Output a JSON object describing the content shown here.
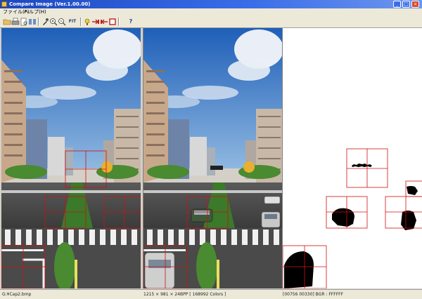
{
  "window": {
    "title": "Compare Image (Ver.1.00.00)",
    "controls": [
      "_",
      "□",
      "×"
    ]
  },
  "menu": {
    "items": [
      "ファイル(F)",
      "ヘルプ(H)"
    ]
  },
  "toolbar": {
    "icons": [
      "open-folder-icon",
      "print-icon",
      "print-preview-icon",
      "compare-icon",
      "eyedropper-icon",
      "zoom-in-icon",
      "zoom-out-icon",
      "fit-to-window-icon",
      "marker-icon",
      "next-diff-icon",
      "prev-diff-icon",
      "stop-icon",
      "help-icon"
    ],
    "fit_label": "FIT",
    "help_label": "?"
  },
  "status": {
    "file": "G:¥Cap2.bmp",
    "image_info": "1215 × 981 × 24BPP [ 168992 Colors ]",
    "cursor_info": "[00756 00330]   BGR : FFFFFF"
  },
  "colors": {
    "titlebar": "#2b5fd9",
    "highlight_box": "#d01010",
    "panel_bg": "#ffffff"
  }
}
